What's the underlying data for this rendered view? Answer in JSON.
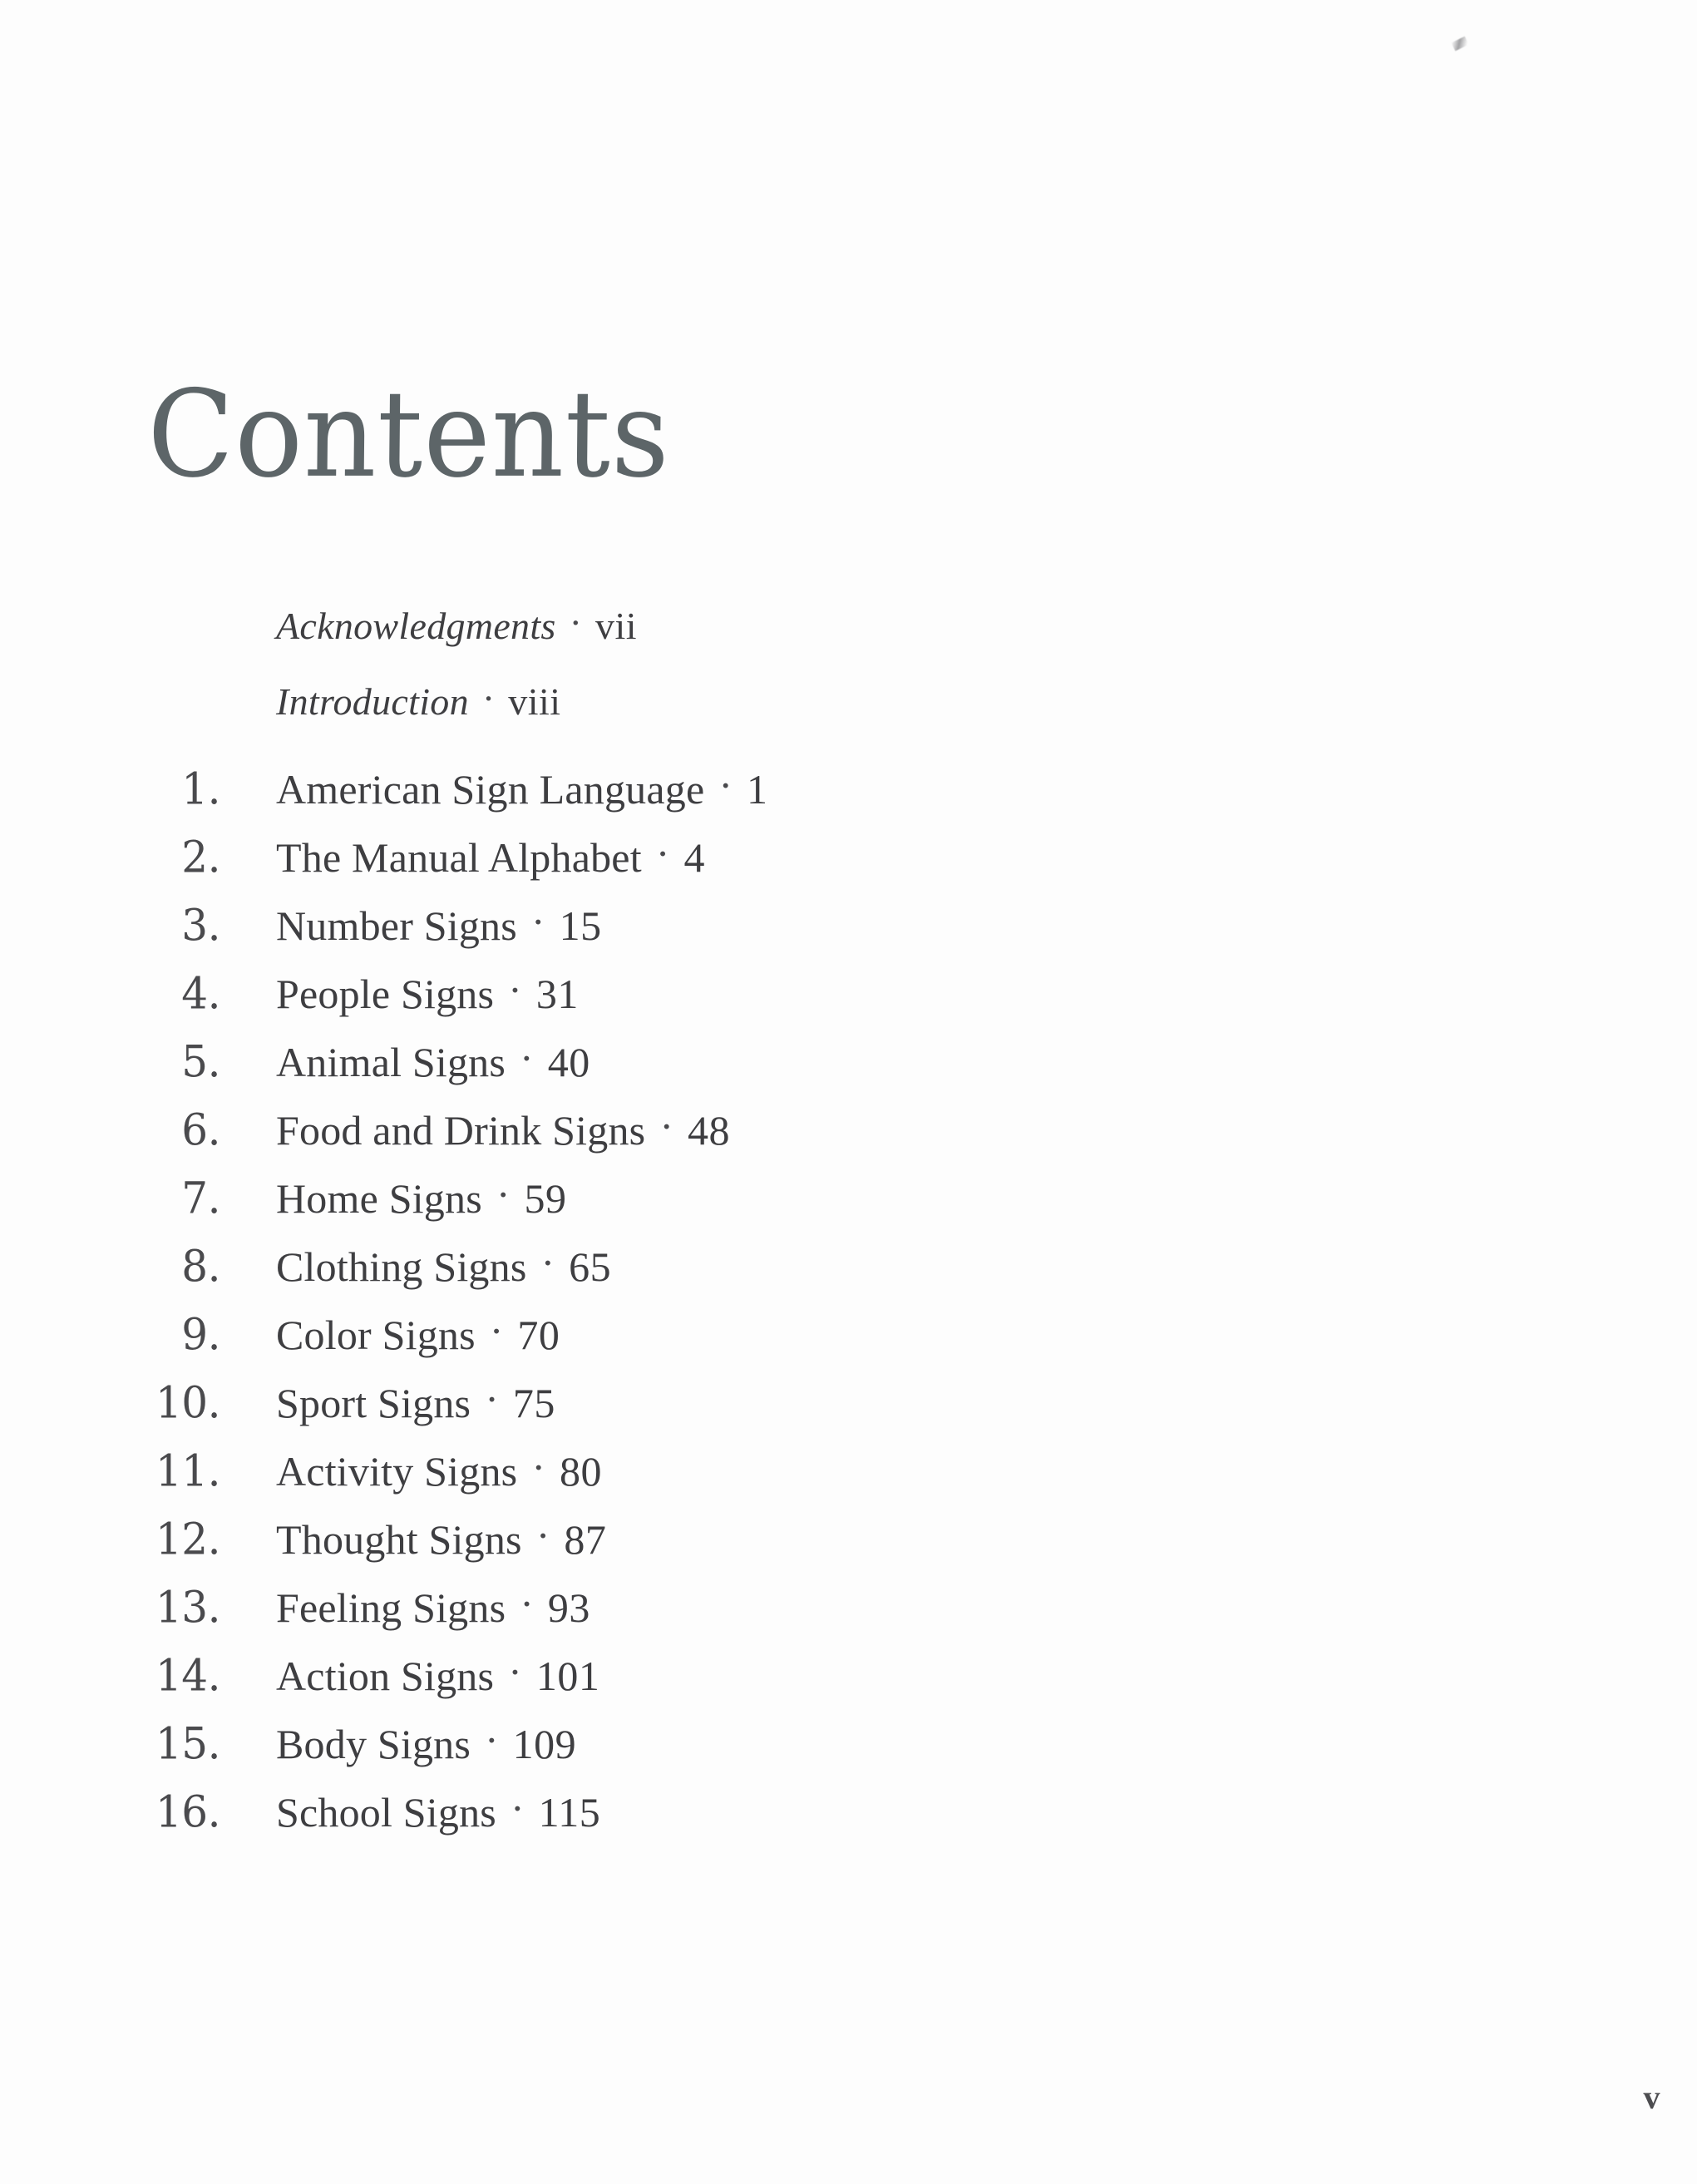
{
  "document": {
    "title": "Contents",
    "folio": "v",
    "colors": {
      "title_ink": "#5d6568",
      "body_ink": "#3e3e41",
      "page_background": "#fdfdfd"
    }
  },
  "front_matter": [
    {
      "label": "Acknowledgments",
      "separator": "·",
      "page": "vii"
    },
    {
      "label": "Introduction",
      "separator": "·",
      "page": "viii"
    }
  ],
  "chapters": [
    {
      "number": "1.",
      "title": "American Sign Language",
      "separator": "·",
      "page": "1"
    },
    {
      "number": "2.",
      "title": "The Manual Alphabet",
      "separator": "·",
      "page": "4"
    },
    {
      "number": "3.",
      "title": "Number Signs",
      "separator": "·",
      "page": "15"
    },
    {
      "number": "4.",
      "title": "People Signs",
      "separator": "·",
      "page": "31"
    },
    {
      "number": "5.",
      "title": "Animal Signs",
      "separator": "·",
      "page": "40"
    },
    {
      "number": "6.",
      "title": "Food and Drink Signs",
      "separator": "·",
      "page": "48"
    },
    {
      "number": "7.",
      "title": "Home Signs",
      "separator": "·",
      "page": "59"
    },
    {
      "number": "8.",
      "title": "Clothing Signs",
      "separator": "·",
      "page": "65"
    },
    {
      "number": "9.",
      "title": "Color Signs",
      "separator": "·",
      "page": "70"
    },
    {
      "number": "10.",
      "title": "Sport Signs",
      "separator": "·",
      "page": "75"
    },
    {
      "number": "11.",
      "title": "Activity Signs",
      "separator": "·",
      "page": "80"
    },
    {
      "number": "12.",
      "title": "Thought Signs",
      "separator": "·",
      "page": "87"
    },
    {
      "number": "13.",
      "title": "Feeling Signs",
      "separator": "·",
      "page": "93"
    },
    {
      "number": "14.",
      "title": "Action Signs",
      "separator": "·",
      "page": "101"
    },
    {
      "number": "15.",
      "title": "Body Signs",
      "separator": "·",
      "page": "109"
    },
    {
      "number": "16.",
      "title": "School Signs",
      "separator": "·",
      "page": "115"
    }
  ]
}
